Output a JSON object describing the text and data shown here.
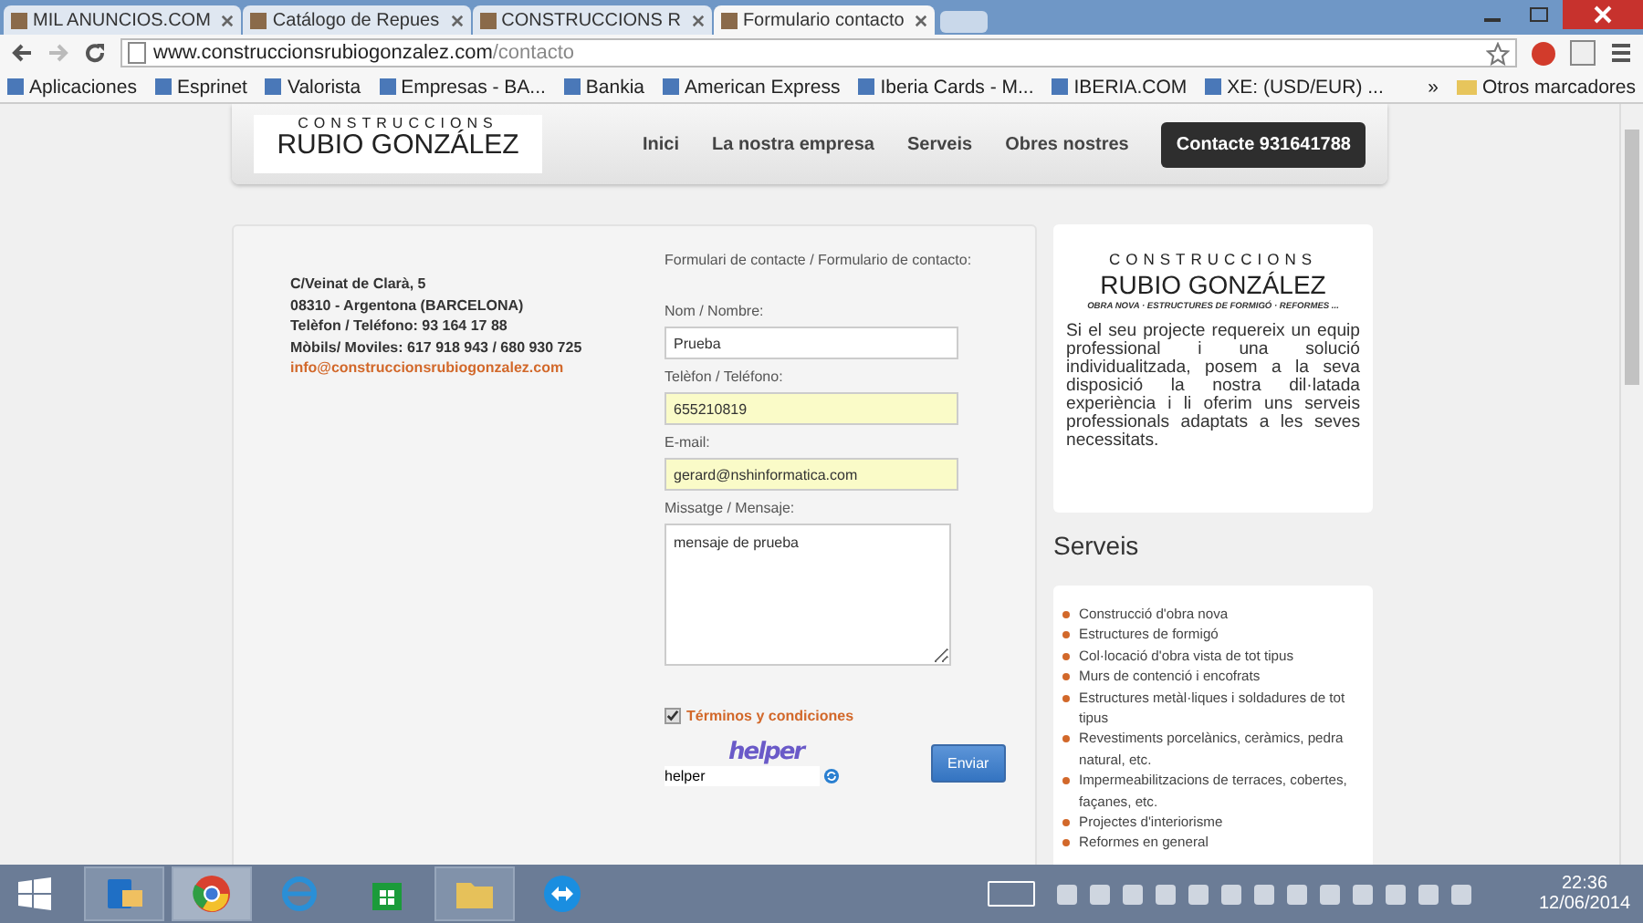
{
  "browser": {
    "tabs": [
      {
        "title": "MIL ANUNCIOS.COM",
        "selected": false
      },
      {
        "title": "Catálogo de Repues",
        "selected": false
      },
      {
        "title": "CONSTRUCCIONS R",
        "selected": false
      },
      {
        "title": "Formulario contacto",
        "selected": true
      }
    ],
    "address": {
      "domain": "www.construccionsrubiogonzalez.com",
      "path": "/contacto"
    },
    "bookmarks": [
      "Aplicaciones",
      "Esprinet",
      "Valorista",
      "Empresas - BA...",
      "Bankia",
      "American Express",
      "Iberia Cards - M...",
      "IBERIA.COM",
      "XE: (USD/EUR) ..."
    ],
    "more": "»",
    "other_bookmarks": "Otros marcadores"
  },
  "header": {
    "logo": {
      "top": "CONSTRUCCIONS",
      "name_1": "RUBIO",
      "name_2": "GONZÁLEZ"
    },
    "nav": [
      {
        "label": "Inici",
        "selected": false
      },
      {
        "label": "La nostra empresa",
        "selected": false
      },
      {
        "label": "Serveis",
        "selected": false
      },
      {
        "label": "Obres nostres",
        "selected": false
      },
      {
        "label": "Contacte 931641788",
        "selected": true
      }
    ]
  },
  "contact": {
    "lines": [
      "C/Veinat de Clarà, 5",
      "08310 - Argentona (BARCELONA)",
      "Telèfon / Teléfono: 93 164 17 88",
      "Mòbils/ Moviles: 617 918 943 / 680 930 725"
    ],
    "email": "info@construccionsrubiogonzalez.com"
  },
  "form": {
    "title": "Formulari de contacte / Formulario de contacto:",
    "fields": [
      {
        "kind": "text",
        "label": "Nom / Nombre:",
        "value": "Prueba",
        "autofilled": false
      },
      {
        "kind": "text",
        "label": "Telèfon / Teléfono:",
        "value": "655210819",
        "autofilled": true
      },
      {
        "kind": "text",
        "label": "E-mail:",
        "value": "gerard@nshinformatica.com",
        "autofilled": true
      },
      {
        "kind": "textarea",
        "label": "Missatge / Mensaje:",
        "value": "mensaje de prueba",
        "autofilled": false
      }
    ],
    "terms": {
      "label": "Términos y condiciones",
      "checked": true
    },
    "captcha": {
      "image_text": "helper",
      "value": "helper"
    },
    "submit": "Enviar"
  },
  "sidebar": {
    "logo": {
      "top": "CONSTRUCCIONS",
      "name_1": "RUBIO",
      "name_2": "GONZÁLEZ",
      "tagline": "OBRA NOVA · ESTRUCTURES DE FORMIGÓ · REFORMES ..."
    },
    "intro": "Si el seu projecte requereix un equip professional i una solució individualitzada, posem a la seva disposició la nostra dil·latada experiència i li oferim uns serveis professionals adaptats a les seves necessitats.",
    "services_title": "Serveis",
    "services": [
      "Construcció d'obra nova",
      "Estructures de formigó",
      "Col·locació d'obra vista de tot tipus",
      "Murs de contenció i encofrats",
      "Estructures metàl·liques i soldadures de tot tipus",
      "Revestiments porcelànics, ceràmics, pedra natural, etc.",
      "Impermeabilitzacions de terraces, cobertes, façanes, etc.",
      "Projectes d'interiorisme",
      "Reformes en general"
    ]
  },
  "taskbar": {
    "apps": [
      {
        "kind": "mail",
        "running": true,
        "selected": false
      },
      {
        "kind": "browser",
        "running": true,
        "selected": true
      },
      {
        "kind": "globe",
        "running": false,
        "selected": false
      },
      {
        "kind": "store",
        "running": false,
        "selected": false
      },
      {
        "kind": "folder",
        "running": true,
        "selected": false
      },
      {
        "kind": "remote",
        "running": false,
        "selected": false
      }
    ],
    "time": "22:36",
    "date": "12/06/2014"
  }
}
